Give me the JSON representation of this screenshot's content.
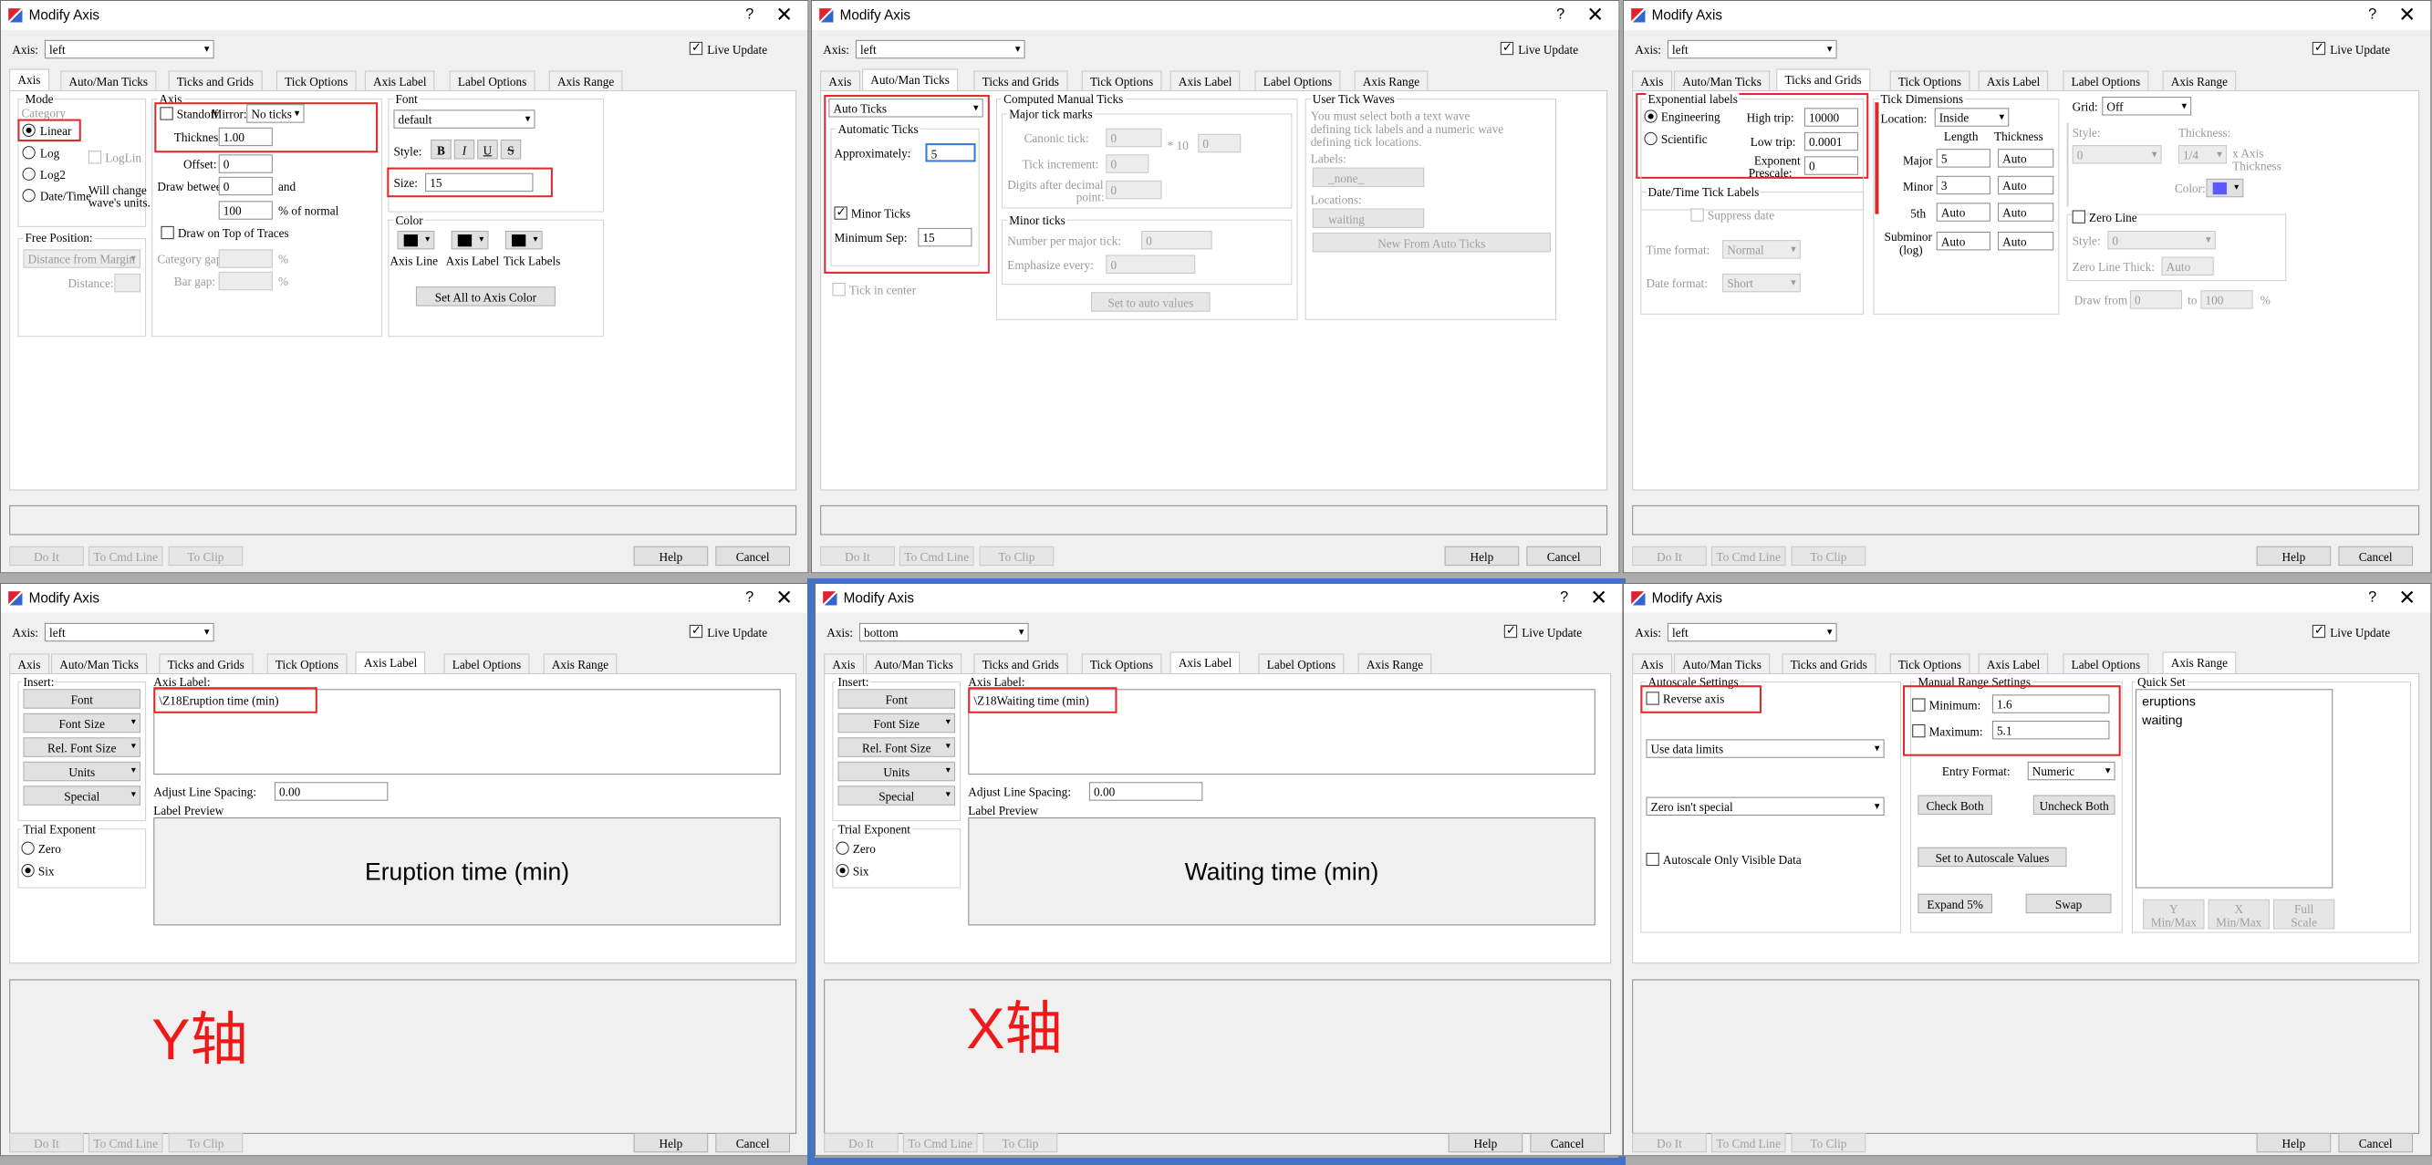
{
  "common": {
    "title": "Modify Axis",
    "help_icon": "?",
    "close_icon": "✕",
    "axis_label": "Axis:",
    "live_update": "Live Update",
    "do_it": "Do It",
    "to_cmd_line": "To Cmd Line",
    "to_clip": "To Clip",
    "help": "Help",
    "cancel": "Cancel",
    "tabs": [
      "Axis",
      "Auto/Man Ticks",
      "Ticks and Grids",
      "Tick Options",
      "Axis Label",
      "Label Options",
      "Axis Range"
    ]
  },
  "d1": {
    "axis": "left",
    "mode_title": "Mode",
    "category": "Category",
    "modes": [
      "Linear",
      "Log",
      "Log2",
      "Date/Time"
    ],
    "loglin": "LogLin",
    "will_change": "Will change",
    "wave_units": "wave's units.",
    "axis_title": "Axis",
    "standoff": "Standoff",
    "mirror": "Mirror:",
    "mirror_val": "No ticks",
    "thickness": "Thickness:",
    "thickness_val": "1.00",
    "offset": "Offset:",
    "offset_val": "0",
    "draw_between": "Draw between",
    "db1": "0",
    "and": "and",
    "db2": "100",
    "pct_normal": "% of normal",
    "draw_on_top": "Draw on Top of Traces",
    "cat_gap": "Category gap:",
    "bar_gap": "Bar gap:",
    "pct": "%",
    "free_pos": "Free Position:",
    "free_val": "Distance from Margin",
    "distance": "Distance:",
    "font_title": "Font",
    "font_val": "default",
    "style": "Style:",
    "b": "B",
    "i": "I",
    "u": "U",
    "s": "S",
    "size": "Size:",
    "size_val": "15",
    "color_title": "Color",
    "axis_line": "Axis Line",
    "axis_lbl": "Axis Label",
    "tick_labels": "Tick Labels",
    "set_all": "Set All to Axis Color"
  },
  "d2": {
    "axis": "left",
    "auto_ticks": "Auto Ticks",
    "automatic_ticks": "Automatic Ticks",
    "approx": "Approximately:",
    "approx_val": "5",
    "minor_ticks": "Minor Ticks",
    "min_sep": "Minimum Sep:",
    "min_sep_val": "15",
    "tick_center": "Tick in center",
    "computed": "Computed Manual Ticks",
    "major_marks": "Major tick marks",
    "canonic": "Canonic tick:",
    "canonic_val": "0",
    "times10": "* 10",
    "exp_val": "0",
    "increment": "Tick increment:",
    "increment_val": "0",
    "digits": "Digits after decimal",
    "point": "point:",
    "digits_val": "0",
    "minor": "Minor ticks",
    "num_per_major": "Number per major tick:",
    "num_val": "0",
    "emphasize": "Emphasize every:",
    "emph_val": "0",
    "set_auto": "Set to auto values",
    "user_waves": "User Tick Waves",
    "uw1": "You must select both a text wave",
    "uw2": "defining tick labels and a numeric wave",
    "uw3": "defining tick locations.",
    "labels": "Labels:",
    "labels_val": "_none_",
    "locations": "Locations:",
    "locations_val": "waiting",
    "new_from": "New From Auto Ticks"
  },
  "d3": {
    "axis": "left",
    "exp_labels": "Exponential labels",
    "engineering": "Engineering",
    "scientific": "Scientific",
    "high_trip": "High trip:",
    "high_val": "10000",
    "low_trip": "Low trip:",
    "low_val": "0.0001",
    "exponent": "Exponent",
    "prescale": "Prescale:",
    "prescale_val": "0",
    "date_labels": "Date/Time Tick Labels",
    "suppress": "Suppress date",
    "time_format": "Time format:",
    "time_val": "Normal",
    "date_format": "Date format:",
    "date_val": "Short",
    "tick_dims": "Tick Dimensions",
    "location": "Location:",
    "location_val": "Inside",
    "length": "Length",
    "thickness": "Thickness",
    "major": "Major",
    "major_len": "5",
    "major_th": "Auto",
    "minor": "Minor",
    "minor_len": "3",
    "minor_th": "Auto",
    "fifth": "5th",
    "fifth_len": "Auto",
    "fifth_th": "Auto",
    "subminor": "Subminor",
    "log": "(log)",
    "sub_len": "Auto",
    "sub_th": "Auto",
    "grid": "Grid:",
    "grid_val": "Off",
    "g_style": "Style:",
    "g_thickness": "Thickness:",
    "g_style_val": "0",
    "g_th_val": "1/4",
    "x_axis": "x Axis",
    "thick2": "Thickness",
    "g_color": "Color:",
    "zero_line": "Zero Line",
    "z_style": "Style:",
    "z_style_val": "0",
    "z_thick": "Zero Line Thick:",
    "z_thick_val": "Auto",
    "draw_from": "Draw from",
    "df1": "0",
    "to": "to",
    "df2": "100",
    "pct": "%"
  },
  "label_common": {
    "insert": "Insert:",
    "font": "Font",
    "font_size": "Font Size",
    "rel_font": "Rel. Font Size",
    "units": "Units",
    "special": "Special",
    "trial_exp": "Trial Exponent",
    "zero": "Zero",
    "six": "Six",
    "axis_label": "Axis Label:",
    "adjust": "Adjust Line Spacing:",
    "adjust_val": "0.00",
    "preview": "Label Preview"
  },
  "d4": {
    "axis": "left",
    "label_text": "\\Z18Eruption time (min)",
    "preview": "Eruption time (min)",
    "annotation": "Y轴"
  },
  "d5": {
    "axis": "bottom",
    "label_text": "\\Z18Waiting time (min)",
    "preview": "Waiting time (min)",
    "annotation": "X轴"
  },
  "d6": {
    "axis": "left",
    "autoscale": "Autoscale Settings",
    "reverse": "Reverse axis",
    "use_data": "Use data limits",
    "zero_special": "Zero isn't special",
    "autoscale_only": "Autoscale Only Visible Data",
    "manual": "Manual Range Settings",
    "minimum": "Minimum:",
    "min_val": "1.6",
    "maximum": "Maximum:",
    "max_val": "5.1",
    "entry_format": "Entry Format:",
    "entry_val": "Numeric",
    "check_both": "Check Both",
    "uncheck_both": "Uncheck Both",
    "set_auto": "Set to Autoscale Values",
    "expand": "Expand 5%",
    "swap": "Swap",
    "quick_set": "Quick Set",
    "quick_items": [
      "eruptions",
      "waiting"
    ],
    "y_minmax": "Y",
    "y_minmax2": "Min/Max",
    "x_minmax": "X",
    "x_minmax2": "Min/Max",
    "full": "Full",
    "scale": "Scale"
  },
  "colors": {
    "highlight": "#e02828",
    "selection_frame": "#4472c4",
    "annotation": "#f01818"
  }
}
